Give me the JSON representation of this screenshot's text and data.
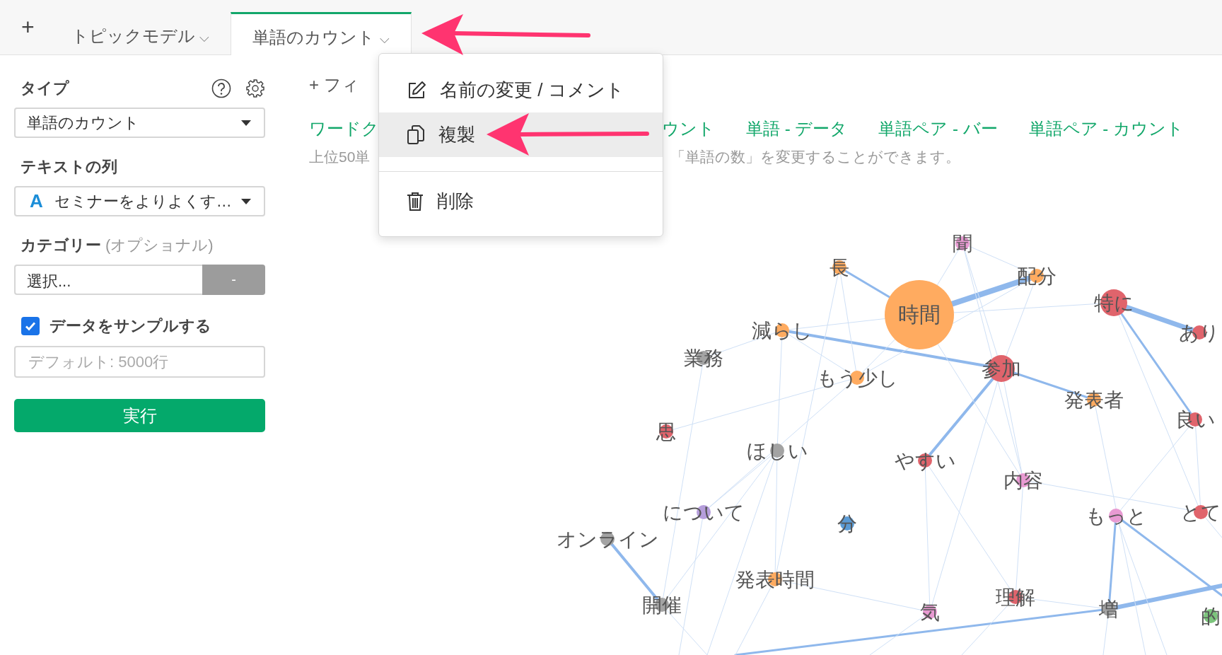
{
  "tab_bar": {
    "add_label": "+",
    "tabs": [
      {
        "label": "トピックモデル",
        "selected": false,
        "caret": "⌵"
      },
      {
        "label": "単語のカウント",
        "selected": true,
        "caret": "⌵"
      }
    ]
  },
  "sidebar": {
    "type": {
      "label": "タイプ",
      "value": "単語のカウント"
    },
    "text_column": {
      "label": "テキストの列",
      "type_badge": "A",
      "value": "セミナーをよりよくす…"
    },
    "category": {
      "label": "カテゴリー",
      "hint": "(オプショナル)",
      "value": "選択...",
      "button": "-"
    },
    "sample": {
      "label": "データをサンプルする",
      "checked": true,
      "placeholder": "デフォルト: 5000行"
    },
    "run_button": "実行"
  },
  "main": {
    "filter_add": "+",
    "filter_label": "フィ",
    "links": [
      "ワードク",
      "ウント",
      "単語 - データ",
      "単語ペア - バー",
      "単語ペア - カウント"
    ],
    "description": [
      "上位50単",
      "「単語の数」を変更することができます。"
    ]
  },
  "menu": {
    "items": [
      {
        "kind": "rename",
        "label": "名前の変更 / コメント",
        "selected": false
      },
      {
        "kind": "copy",
        "label": "複製",
        "selected": true
      },
      {
        "kind": "delete",
        "label": "削除",
        "selected": false
      }
    ]
  },
  "graph": {
    "nodes": [
      {
        "label": "聞",
        "color": "#e89ad2",
        "kind": "minor"
      },
      {
        "label": "長",
        "color": "#ffab60",
        "kind": "minor"
      },
      {
        "label": "時間",
        "color": "#ffab60",
        "kind": "major"
      },
      {
        "label": "配分",
        "color": "#ffab60",
        "kind": "minor"
      },
      {
        "label": "特に",
        "color": "#e0646c",
        "kind": "medium"
      },
      {
        "label": "あり",
        "color": "#e0646c",
        "kind": "minor"
      },
      {
        "label": "減らし",
        "color": "#ffab60",
        "kind": "minor"
      },
      {
        "label": "業務",
        "color": "#a3a3a3",
        "kind": "minor"
      },
      {
        "label": "参加",
        "color": "#e0646c",
        "kind": "medium"
      },
      {
        "label": "もう少し",
        "color": "#ffab60",
        "kind": "minor"
      },
      {
        "label": "発表者",
        "color": "#ffab60",
        "kind": "minor"
      },
      {
        "label": "良い",
        "color": "#e0646c",
        "kind": "minor"
      },
      {
        "label": "思",
        "color": "#e0646c",
        "kind": "minor"
      },
      {
        "label": "ほしい",
        "color": "#a3a3a3",
        "kind": "minor"
      },
      {
        "label": "やすい",
        "color": "#e0646c",
        "kind": "minor"
      },
      {
        "label": "内容",
        "color": "#e89ad2",
        "kind": "minor"
      },
      {
        "label": "について",
        "color": "#b59ddb",
        "kind": "minor"
      },
      {
        "label": "分",
        "color": "#5b9bd5",
        "kind": "minor"
      },
      {
        "label": "もっと",
        "color": "#e89ad2",
        "kind": "minor"
      },
      {
        "label": "とて",
        "color": "#e0646c",
        "kind": "minor"
      },
      {
        "label": "オンライン",
        "color": "#a3a3a3",
        "kind": "minor"
      },
      {
        "label": "発表時間",
        "color": "#ffab60",
        "kind": "minor"
      },
      {
        "label": "開催",
        "color": "#a3a3a3",
        "kind": "minor"
      },
      {
        "label": "気",
        "color": "#e89ad2",
        "kind": "minor"
      },
      {
        "label": "理解",
        "color": "#e0646c",
        "kind": "minor"
      },
      {
        "label": "増",
        "color": "#a3a3a3",
        "kind": "minor"
      },
      {
        "label": "的",
        "color": "#7cc47c",
        "kind": "minor"
      }
    ]
  }
}
